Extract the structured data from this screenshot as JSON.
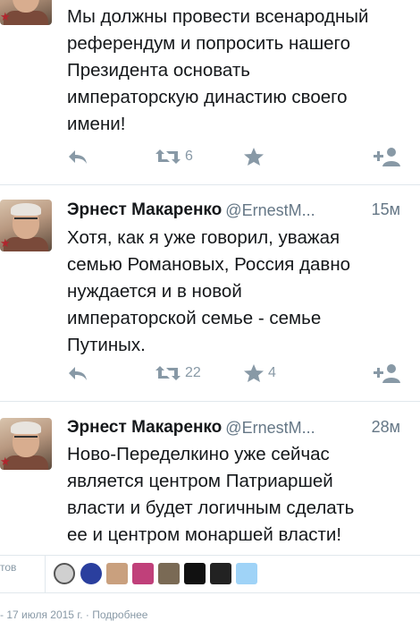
{
  "tweets": [
    {
      "text": "Мы должны провести всенародный\nреферендум и попросить нашего\nПрезидента основать\nимператорскую династию своего\nимени!",
      "retweets": "6",
      "favorites": ""
    },
    {
      "name": "Эрнест Макаренко",
      "handle": "@ErnestM...",
      "time": "15м",
      "text": "Хотя, как я уже говорил, уважая\nсемью Романовых, Россия давно\nнуждается и в новой\nимператорской семье - семье\nПутиных.",
      "retweets": "22",
      "favorites": "4"
    },
    {
      "name": "Эрнест Макаренко",
      "handle": "@ErnestM...",
      "time": "28м",
      "text": "Ново-Переделкино уже сейчас\nявляется центром Патриаршей\nвласти и будет логичным сделать\nее и центром монаршей власти!"
    }
  ],
  "footer": {
    "favorites_label": "тов",
    "date_line": "- 17 июля 2015 г. · Подробнее"
  },
  "colors": {
    "icon": "#8899a6",
    "separator": "#e1e8ed",
    "text": "#14171a",
    "muted": "#657786"
  }
}
